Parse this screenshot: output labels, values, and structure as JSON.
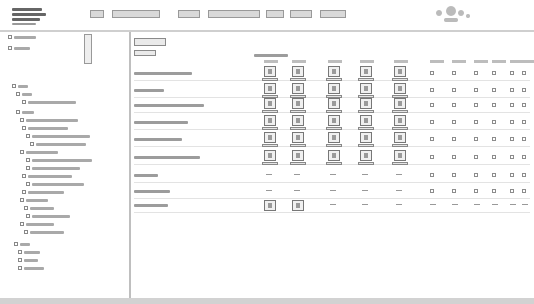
{
  "header": {
    "app_title": "",
    "banner_text": ""
  },
  "sidebar": {
    "items": [
      {
        "label": ""
      },
      {
        "label": ""
      },
      {
        "label": ""
      },
      {
        "label": ""
      },
      {
        "label": ""
      },
      {
        "label": ""
      },
      {
        "label": ""
      },
      {
        "label": ""
      },
      {
        "label": ""
      },
      {
        "label": ""
      },
      {
        "label": ""
      },
      {
        "label": ""
      },
      {
        "label": ""
      },
      {
        "label": ""
      },
      {
        "label": ""
      },
      {
        "label": ""
      },
      {
        "label": ""
      },
      {
        "label": ""
      },
      {
        "label": ""
      },
      {
        "label": ""
      },
      {
        "label": ""
      },
      {
        "label": ""
      },
      {
        "label": ""
      },
      {
        "label": ""
      },
      {
        "label": ""
      }
    ]
  },
  "main": {
    "title": "",
    "subtitle": "",
    "section_heading": "",
    "columns": [
      {
        "label": ""
      },
      {
        "label": ""
      },
      {
        "label": ""
      },
      {
        "label": ""
      },
      {
        "label": ""
      },
      {
        "label": ""
      },
      {
        "label": ""
      },
      {
        "label": ""
      },
      {
        "label": ""
      },
      {
        "label": ""
      },
      {
        "label": ""
      },
      {
        "label": ""
      }
    ],
    "rows": [
      {
        "label": ""
      },
      {
        "label": ""
      },
      {
        "label": ""
      },
      {
        "label": ""
      },
      {
        "label": ""
      },
      {
        "label": ""
      },
      {
        "label": ""
      },
      {
        "label": ""
      },
      {
        "label": ""
      }
    ]
  },
  "colors": {
    "background": "#ffffff",
    "rule": "#cfcfcf",
    "statusbar": "#d2d2d2"
  }
}
